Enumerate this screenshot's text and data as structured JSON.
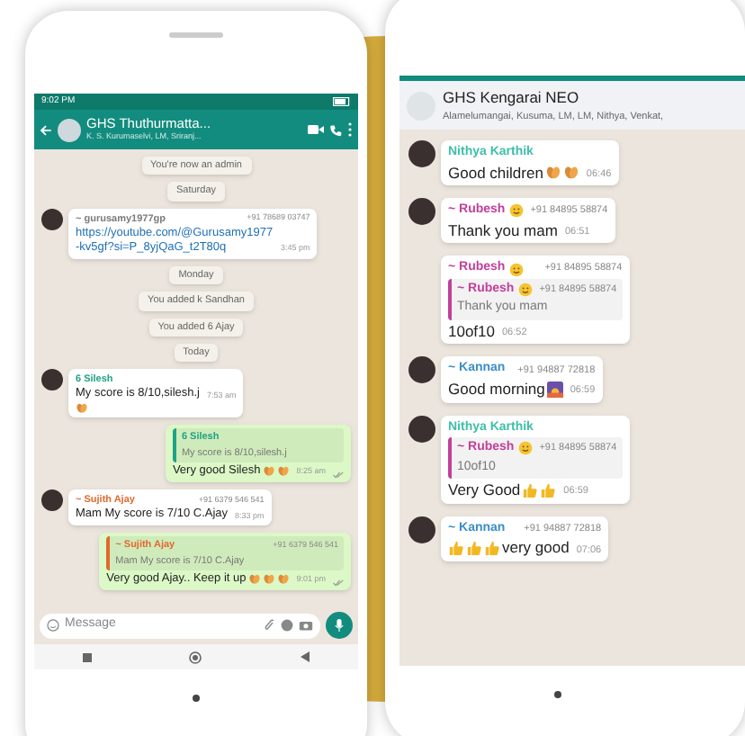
{
  "left_phone": {
    "status_bar": {
      "time": "9:02 PM"
    },
    "header": {
      "title": "GHS Thuthurmatta...",
      "subtitle": "K. S. Kurumaselvi, LM, Sriranj..."
    },
    "messages": [
      {
        "kind": "system",
        "text": "You're now an admin"
      },
      {
        "kind": "system",
        "text": "Saturday"
      },
      {
        "kind": "in",
        "avatar": true,
        "sender": "~ gurusamy1977gp",
        "color": "#7a7a7a",
        "phone": "+91 78689 03747",
        "link": true,
        "text": "https://youtube.com/@Gurusamy1977-kv5gf?si=P_8yjQaG_t2T80q",
        "time": "3:45 pm"
      },
      {
        "kind": "system",
        "text": "Monday"
      },
      {
        "kind": "system",
        "text": "You added k Sandhan"
      },
      {
        "kind": "system",
        "text": "You added 6 Ajay"
      },
      {
        "kind": "system",
        "text": "Today"
      },
      {
        "kind": "in",
        "avatar": true,
        "sender": "6 Silesh",
        "color": "#1fa385",
        "text": "My score is 8/10,silesh.j",
        "time": "7:53 am",
        "emojis_below": [
          {
            "kind": "clap"
          }
        ]
      },
      {
        "kind": "out",
        "quote": {
          "sender": "6 Silesh",
          "color": "#1fa385",
          "text": "My score is 8/10,silesh.j"
        },
        "text": "Very good Silesh",
        "emojis": [
          {
            "kind": "clap"
          },
          {
            "kind": "clap"
          }
        ],
        "time": "8:25 am"
      },
      {
        "kind": "in",
        "avatar": true,
        "sender": "~ Sujith Ajay",
        "color": "#e0692d",
        "phone": "+91 6379 546 541",
        "text": "Mam My score is 7/10 C.Ajay",
        "time": "8:33 pm"
      },
      {
        "kind": "out",
        "quote": {
          "sender": "~ Sujith Ajay",
          "color": "#e0692d",
          "phone": "+91 6379 546 541",
          "text": "Mam My score is 7/10 C.Ajay"
        },
        "text": "Very good Ajay.. Keep it up",
        "emojis": [
          {
            "kind": "clap"
          },
          {
            "kind": "clap"
          },
          {
            "kind": "clap"
          }
        ],
        "time": "9:01 pm"
      }
    ],
    "composer": {
      "placeholder": "Message"
    }
  },
  "right_phone": {
    "header": {
      "title": "GHS Kengarai NEO",
      "subtitle": "Alamelumangai, Kusuma, LM, LM, Nithya, Venkat,"
    },
    "messages": [
      {
        "kind": "in",
        "avatar": true,
        "sender": "Nithya Karthik",
        "color": "#3fbfa8",
        "text": "Good children",
        "emojis": [
          {
            "kind": "clap"
          },
          {
            "kind": "clap"
          }
        ],
        "time": "06:46"
      },
      {
        "kind": "in",
        "avatar": true,
        "sender": "~ Rubesh",
        "sender_emoji": {
          "kind": "smile"
        },
        "color": "#c2409a",
        "phone": "+91 84895 58874",
        "text": "Thank you mam",
        "time": "06:51"
      },
      {
        "kind": "in",
        "avatar": false,
        "sender": "~ Rubesh",
        "sender_emoji": {
          "kind": "smile"
        },
        "color": "#c2409a",
        "phone": "+91 84895 58874",
        "quote": {
          "sender": "~ Rubesh",
          "sender_emoji": {
            "kind": "smile"
          },
          "color": "#c2409a",
          "phone": "+91 84895 58874",
          "text": "Thank you mam"
        },
        "text": "10of10",
        "time": "06:52"
      },
      {
        "kind": "in",
        "avatar": true,
        "sender": "~ Kannan",
        "color": "#3a8fc7",
        "phone": "+91 94887 72818",
        "text": "Good morning",
        "emojis": [
          {
            "kind": "sunrise"
          }
        ],
        "time": "06:59"
      },
      {
        "kind": "in",
        "avatar": true,
        "sender": "Nithya Karthik",
        "color": "#3fbfa8",
        "quote": {
          "sender": "~ Rubesh",
          "sender_emoji": {
            "kind": "smile"
          },
          "color": "#c2409a",
          "phone": "+91 84895 58874",
          "text": "10of10"
        },
        "text": "Very Good",
        "emojis": [
          {
            "kind": "thumbs"
          },
          {
            "kind": "thumbs"
          }
        ],
        "time": "06:59"
      },
      {
        "kind": "in",
        "avatar": true,
        "sender": "~ Kannan",
        "color": "#3a8fc7",
        "phone": "+91 94887 72818",
        "emojis_before": [
          {
            "kind": "thumbs"
          },
          {
            "kind": "thumbs"
          },
          {
            "kind": "thumbs"
          }
        ],
        "text": "very good",
        "time": "07:06"
      }
    ]
  }
}
